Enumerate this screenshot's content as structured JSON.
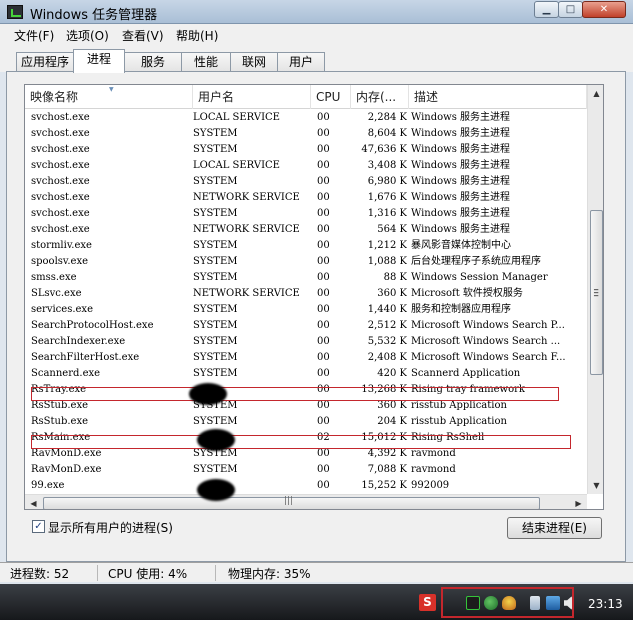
{
  "window": {
    "title": "Windows 任务管理器",
    "min_glyph": "▁",
    "max_glyph": "□",
    "close_glyph": "✕"
  },
  "menu": [
    "文件(F)",
    "选项(O)",
    "查看(V)",
    "帮助(H)"
  ],
  "tabs": [
    "应用程序",
    "进程",
    "服务",
    "性能",
    "联网",
    "用户"
  ],
  "active_tab": "进程",
  "columns": [
    "映像名称",
    "用户名",
    "CPU",
    "内存(...",
    "描述"
  ],
  "rows": [
    {
      "name": "svchost.exe",
      "user": "LOCAL SERVICE",
      "cpu": "00",
      "mem": "2,284 K",
      "desc": "Windows 服务主进程"
    },
    {
      "name": "svchost.exe",
      "user": "SYSTEM",
      "cpu": "00",
      "mem": "8,604 K",
      "desc": "Windows 服务主进程"
    },
    {
      "name": "svchost.exe",
      "user": "SYSTEM",
      "cpu": "00",
      "mem": "47,636 K",
      "desc": "Windows 服务主进程"
    },
    {
      "name": "svchost.exe",
      "user": "LOCAL SERVICE",
      "cpu": "00",
      "mem": "3,408 K",
      "desc": "Windows 服务主进程"
    },
    {
      "name": "svchost.exe",
      "user": "SYSTEM",
      "cpu": "00",
      "mem": "6,980 K",
      "desc": "Windows 服务主进程"
    },
    {
      "name": "svchost.exe",
      "user": "NETWORK SERVICE",
      "cpu": "00",
      "mem": "1,676 K",
      "desc": "Windows 服务主进程"
    },
    {
      "name": "svchost.exe",
      "user": "SYSTEM",
      "cpu": "00",
      "mem": "1,316 K",
      "desc": "Windows 服务主进程"
    },
    {
      "name": "svchost.exe",
      "user": "NETWORK SERVICE",
      "cpu": "00",
      "mem": "564 K",
      "desc": "Windows 服务主进程"
    },
    {
      "name": "stormliv.exe",
      "user": "SYSTEM",
      "cpu": "00",
      "mem": "1,212 K",
      "desc": "暴风影音媒体控制中心"
    },
    {
      "name": "spoolsv.exe",
      "user": "SYSTEM",
      "cpu": "00",
      "mem": "1,088 K",
      "desc": "后台处理程序子系统应用程序"
    },
    {
      "name": "smss.exe",
      "user": "SYSTEM",
      "cpu": "00",
      "mem": "88 K",
      "desc": "Windows Session Manager"
    },
    {
      "name": "SLsvc.exe",
      "user": "NETWORK SERVICE",
      "cpu": "00",
      "mem": "360 K",
      "desc": "Microsoft 软件授权服务"
    },
    {
      "name": "services.exe",
      "user": "SYSTEM",
      "cpu": "00",
      "mem": "1,440 K",
      "desc": "服务和控制器应用程序"
    },
    {
      "name": "SearchProtocolHost.exe",
      "user": "SYSTEM",
      "cpu": "00",
      "mem": "2,512 K",
      "desc": "Microsoft Windows Search P..."
    },
    {
      "name": "SearchIndexer.exe",
      "user": "SYSTEM",
      "cpu": "00",
      "mem": "5,532 K",
      "desc": "Microsoft Windows Search ..."
    },
    {
      "name": "SearchFilterHost.exe",
      "user": "SYSTEM",
      "cpu": "00",
      "mem": "2,408 K",
      "desc": "Microsoft Windows Search F..."
    },
    {
      "name": "Scannerd.exe",
      "user": "SYSTEM",
      "cpu": "00",
      "mem": "420 K",
      "desc": "Scannerd Application"
    },
    {
      "name": "RsTray.exe",
      "user": "",
      "cpu": "00",
      "mem": "13,268 K",
      "desc": "Rising tray framework"
    },
    {
      "name": "RsStub.exe",
      "user": "SYSTEM",
      "cpu": "00",
      "mem": "360 K",
      "desc": "risstub Application"
    },
    {
      "name": "RsStub.exe",
      "user": "SYSTEM",
      "cpu": "00",
      "mem": "204 K",
      "desc": "risstub Application"
    },
    {
      "name": "RsMain.exe",
      "user": "",
      "cpu": "02",
      "mem": "15,012 K",
      "desc": "Rising RsShell"
    },
    {
      "name": "RavMonD.exe",
      "user": "SYSTEM",
      "cpu": "00",
      "mem": "4,392 K",
      "desc": "ravmond"
    },
    {
      "name": "RavMonD.exe",
      "user": "SYSTEM",
      "cpu": "00",
      "mem": "7,088 K",
      "desc": "ravmond"
    },
    {
      "name": "99.exe",
      "user": "",
      "cpu": "00",
      "mem": "15,252 K",
      "desc": "992009"
    }
  ],
  "show_all_label": "显示所有用户的进程(S)",
  "show_all_checked": true,
  "end_process_label": "结束进程(E)",
  "status": {
    "processes": "进程数: 52",
    "cpu": "CPU 使用: 4%",
    "memory": "物理内存: 35%"
  },
  "clock": "23:13",
  "tray_icons": [
    "rising-s-icon",
    "monitor-icon",
    "network-globe-icon",
    "qq-penguin-icon",
    "usb-device-icon",
    "network-connection-icon",
    "volume-icon"
  ],
  "colors": {
    "highlight_red": "#c4272d",
    "taskbar": "#1f2226"
  }
}
